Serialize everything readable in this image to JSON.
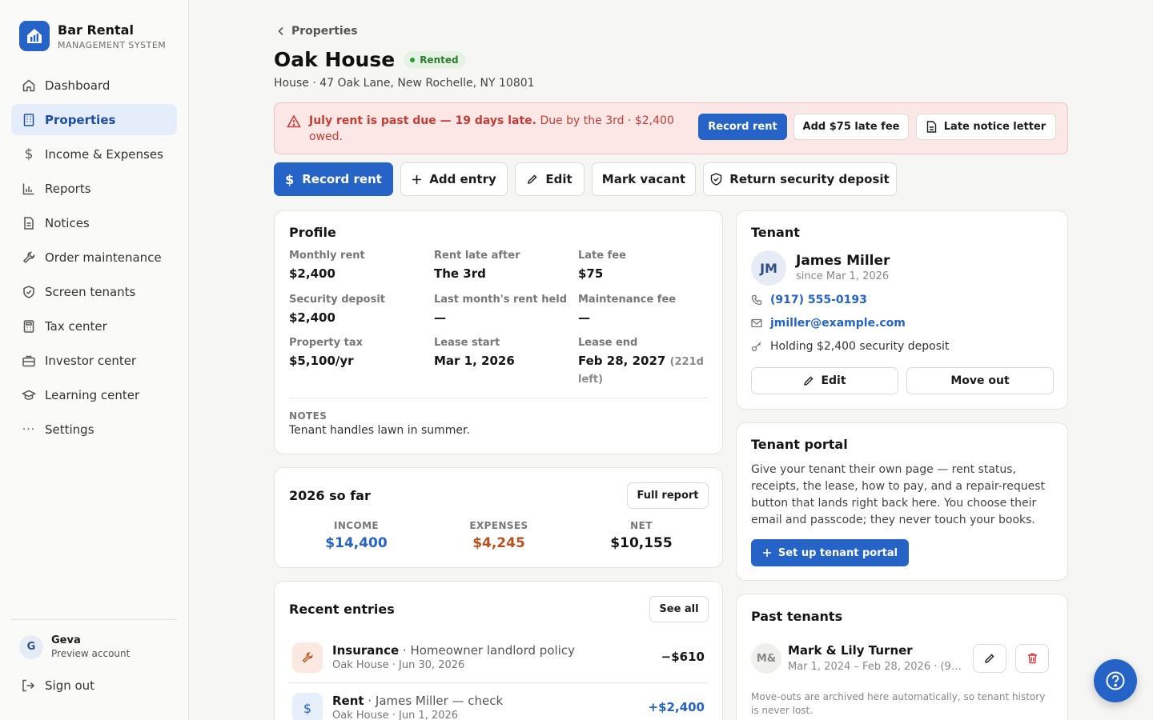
{
  "brand": {
    "name": "Bar Rental",
    "subtitle": "MANAGEMENT SYSTEM"
  },
  "sidebar": {
    "items": [
      {
        "label": "Dashboard",
        "icon": "home-icon"
      },
      {
        "label": "Properties",
        "icon": "building-icon",
        "active": true
      },
      {
        "label": "Income & Expenses",
        "icon": "dollar-icon"
      },
      {
        "label": "Reports",
        "icon": "bar-chart-icon"
      },
      {
        "label": "Notices",
        "icon": "document-icon"
      },
      {
        "label": "Order maintenance",
        "icon": "wrench-icon"
      },
      {
        "label": "Screen tenants",
        "icon": "shield-check-icon"
      },
      {
        "label": "Tax center",
        "icon": "calculator-icon"
      },
      {
        "label": "Investor center",
        "icon": "briefcase-icon"
      },
      {
        "label": "Learning center",
        "icon": "graduation-cap-icon"
      },
      {
        "label": "Settings",
        "icon": "ellipsis-icon"
      }
    ],
    "user": {
      "initial": "G",
      "name": "Geva",
      "role": "Preview account"
    },
    "signout": "Sign out"
  },
  "breadcrumb": {
    "label": "Properties"
  },
  "property": {
    "name": "Oak House",
    "status": "Rented",
    "subtitle": "House · 47 Oak Lane, New Rochelle, NY 10801"
  },
  "alert": {
    "bold": "July rent is past due — 19 days late.",
    "detail": " Due by the 3rd · $2,400 owed.",
    "record_rent": "Record rent",
    "late_fee": "Add $75 late fee",
    "late_notice": "Late notice letter"
  },
  "actions": {
    "record_rent": "Record rent",
    "add_entry": "Add entry",
    "edit": "Edit",
    "mark_vacant": "Mark vacant",
    "return_deposit": "Return security deposit"
  },
  "profile": {
    "title": "Profile",
    "fields": [
      {
        "label": "Monthly rent",
        "value": "$2,400"
      },
      {
        "label": "Rent late after",
        "value": "The 3rd"
      },
      {
        "label": "Late fee",
        "value": "$75"
      },
      {
        "label": "Security deposit",
        "value": "$2,400"
      },
      {
        "label": "Last month's rent held",
        "value": "—"
      },
      {
        "label": "Maintenance fee",
        "value": "—"
      },
      {
        "label": "Property tax",
        "value": "$5,100/yr"
      },
      {
        "label": "Lease start",
        "value": "Mar 1, 2026"
      },
      {
        "label": "Lease end",
        "value": "Feb 28, 2027",
        "extra": "(221d left)"
      }
    ],
    "notes_label": "NOTES",
    "notes": "Tenant handles lawn in summer."
  },
  "summary": {
    "title": "2026 so far",
    "full_report": "Full report",
    "income_label": "INCOME",
    "income": "$14,400",
    "expenses_label": "EXPENSES",
    "expenses": "$4,245",
    "net_label": "NET",
    "net": "$10,155",
    "colors": {
      "income": "#2563c7",
      "expenses": "#b8501f",
      "net": "#151515"
    }
  },
  "recent": {
    "title": "Recent entries",
    "see_all": "See all",
    "entries": [
      {
        "category": "Insurance",
        "desc": "Homeowner landlord policy",
        "sub": "Oak House · Jun 30, 2026",
        "amount": "−$610",
        "icon": "wrench-icon"
      },
      {
        "category": "Rent",
        "desc": "James Miller — check",
        "sub": "Oak House · Jun 1, 2026",
        "amount": "+$2,400",
        "icon": "dollar-icon"
      }
    ]
  },
  "tenant": {
    "title": "Tenant",
    "initials": "JM",
    "name": "James Miller",
    "since": "since Mar 1, 2026",
    "phone": "(917) 555-0193",
    "email": "jmiller@example.com",
    "deposit": "Holding $2,400 security deposit",
    "edit": "Edit",
    "move_out": "Move out"
  },
  "portal": {
    "title": "Tenant portal",
    "text": "Give your tenant their own page — rent status, receipts, the lease, how to pay, and a repair-request button that lands right back here. You choose their email and passcode; they never touch your books.",
    "button": "Set up tenant portal"
  },
  "past": {
    "title": "Past tenants",
    "initials": "M&",
    "name": "Mark & Lily Turner",
    "dates": "Mar 1, 2024 – Feb 28, 2026 · (91...",
    "footer": "Move-outs are archived here automatically, so tenant history is never lost."
  }
}
